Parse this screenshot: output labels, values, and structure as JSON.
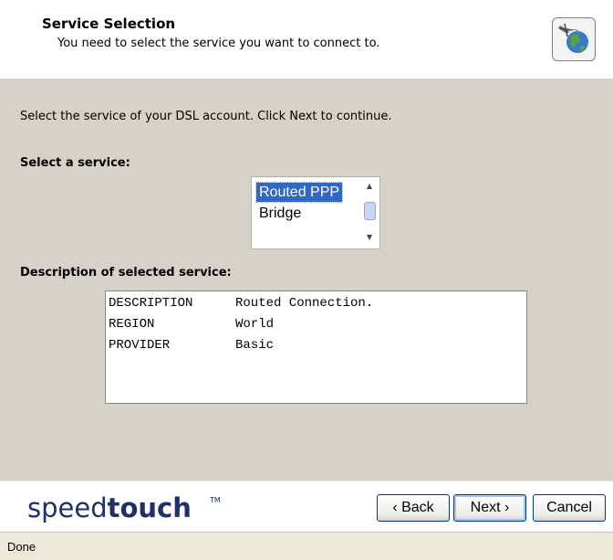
{
  "header": {
    "title": "Service Selection",
    "subtitle": "You need to select the service you want to connect to.",
    "icon": "network-globe-icon"
  },
  "content": {
    "instruction": "Select the service of your DSL account. Click Next to continue.",
    "service_label": "Select a service:",
    "services": [
      "Routed PPP",
      "Bridge"
    ],
    "selected_service": "Routed PPP",
    "description_label": "Description of selected service:",
    "description": [
      {
        "key": "DESCRIPTION",
        "value": "Routed Connection."
      },
      {
        "key": "REGION",
        "value": "World"
      },
      {
        "key": "PROVIDER",
        "value": "Basic"
      }
    ]
  },
  "footer": {
    "logo_light": "speed",
    "logo_bold": "touch",
    "logo_tm": "TM",
    "back_label": "‹ Back",
    "next_label": "Next ›",
    "cancel_label": "Cancel"
  },
  "status": {
    "text": "Done"
  },
  "colors": {
    "panel_bg": "#d5d2ca",
    "selection": "#3168c4",
    "brand": "#1e2f6a"
  }
}
